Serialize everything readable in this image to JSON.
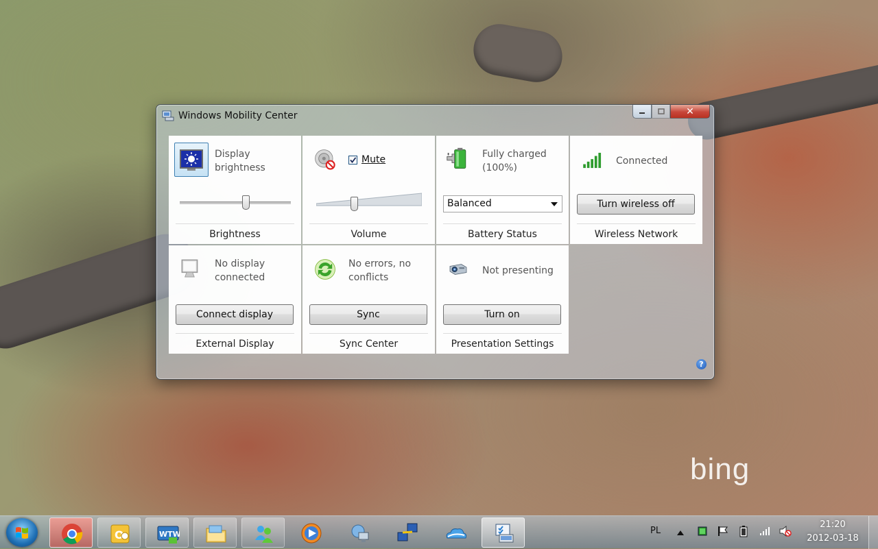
{
  "window": {
    "title": "Windows Mobility Center",
    "close_glyph": "✕",
    "help_glyph": "?"
  },
  "tiles": {
    "brightness": {
      "status": "Display brightness",
      "label": "Brightness",
      "level": 0.6
    },
    "volume": {
      "mute_label": "Mute",
      "mute_checked": true,
      "label": "Volume",
      "level": 0.35
    },
    "battery": {
      "status": "Fully charged (100%)",
      "plan": "Balanced",
      "label": "Battery Status"
    },
    "wireless": {
      "status": "Connected",
      "button": "Turn wireless off",
      "label": "Wireless Network"
    },
    "external_display": {
      "status": "No display connected",
      "button": "Connect display",
      "label": "External Display"
    },
    "sync": {
      "status": "No errors, no conflicts",
      "button": "Sync",
      "label": "Sync Center"
    },
    "presentation": {
      "status": "Not presenting",
      "button": "Turn on",
      "label": "Presentation Settings"
    }
  },
  "desktop": {
    "watermark": "bing"
  },
  "taskbar": {
    "items": [
      {
        "name": "chrome-icon"
      },
      {
        "name": "outlook-icon"
      },
      {
        "name": "wtw-icon",
        "text": "WTW"
      },
      {
        "name": "explorer-icon"
      },
      {
        "name": "messenger-icon"
      },
      {
        "name": "media-player-icon"
      },
      {
        "name": "network-icon"
      },
      {
        "name": "remote-desktop-icon"
      },
      {
        "name": "skydrive-icon"
      },
      {
        "name": "mobility-center-icon"
      }
    ],
    "language": "PL",
    "time": "21:20",
    "date": "2012-03-18"
  },
  "colors": {
    "accent": "#1f6fb4",
    "close_red": "#c7463a",
    "chrome_item_bg": "#e05c4f"
  }
}
